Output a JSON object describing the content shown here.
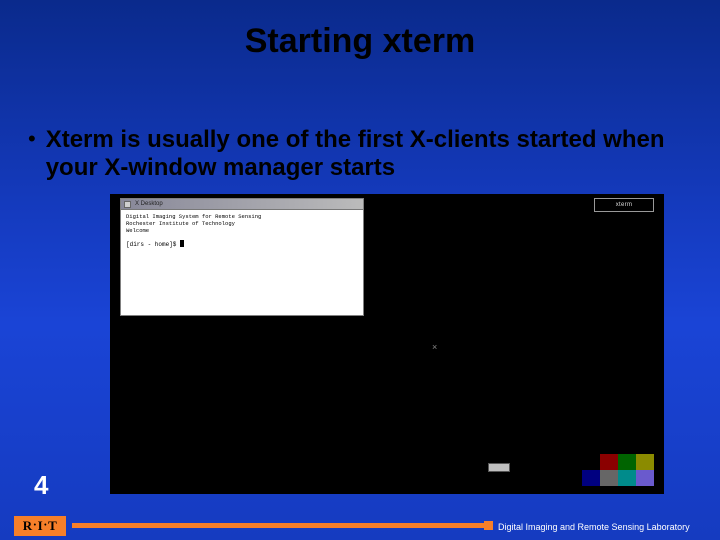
{
  "title": "Starting xterm",
  "bullet": "Xterm is usually one of the first X-clients started when your X-window manager starts",
  "page_number": "4",
  "screenshot": {
    "window_title": "X Desktop",
    "motd_line1": "Digital Imaging System for Remote Sensing",
    "motd_line2": "Rochester Institute of Technology",
    "motd_line3": "Welcome",
    "prompt": "[dirs - home]$ ",
    "menu_label": "xterm",
    "center_mark": "×",
    "color_cells": [
      "#000000",
      "#8b0000",
      "#006400",
      "#8b8b00",
      "#000080",
      "#666666",
      "#008b8b",
      "#6a5acd"
    ]
  },
  "footer": {
    "logo_r": "R",
    "logo_i": "I",
    "logo_t": "T",
    "lab": "Digital Imaging and Remote Sensing Laboratory"
  }
}
